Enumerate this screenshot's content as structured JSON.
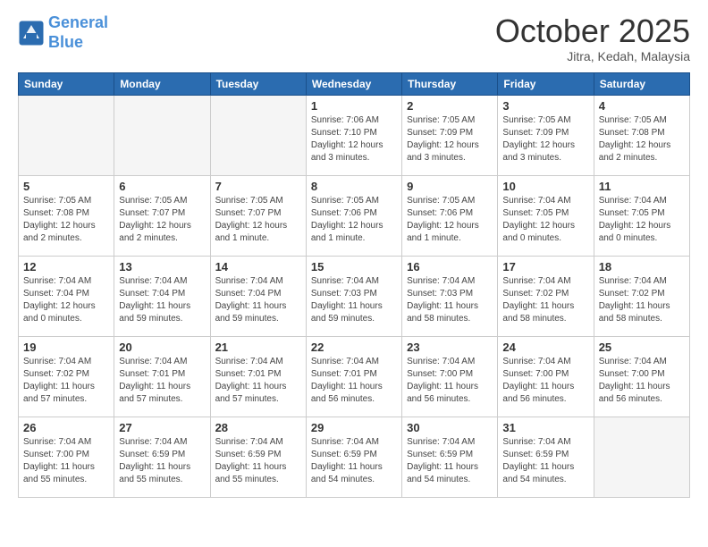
{
  "header": {
    "logo_line1": "General",
    "logo_line2": "Blue",
    "month": "October 2025",
    "location": "Jitra, Kedah, Malaysia"
  },
  "weekdays": [
    "Sunday",
    "Monday",
    "Tuesday",
    "Wednesday",
    "Thursday",
    "Friday",
    "Saturday"
  ],
  "weeks": [
    [
      {
        "day": "",
        "info": ""
      },
      {
        "day": "",
        "info": ""
      },
      {
        "day": "",
        "info": ""
      },
      {
        "day": "1",
        "info": "Sunrise: 7:06 AM\nSunset: 7:10 PM\nDaylight: 12 hours\nand 3 minutes."
      },
      {
        "day": "2",
        "info": "Sunrise: 7:05 AM\nSunset: 7:09 PM\nDaylight: 12 hours\nand 3 minutes."
      },
      {
        "day": "3",
        "info": "Sunrise: 7:05 AM\nSunset: 7:09 PM\nDaylight: 12 hours\nand 3 minutes."
      },
      {
        "day": "4",
        "info": "Sunrise: 7:05 AM\nSunset: 7:08 PM\nDaylight: 12 hours\nand 2 minutes."
      }
    ],
    [
      {
        "day": "5",
        "info": "Sunrise: 7:05 AM\nSunset: 7:08 PM\nDaylight: 12 hours\nand 2 minutes."
      },
      {
        "day": "6",
        "info": "Sunrise: 7:05 AM\nSunset: 7:07 PM\nDaylight: 12 hours\nand 2 minutes."
      },
      {
        "day": "7",
        "info": "Sunrise: 7:05 AM\nSunset: 7:07 PM\nDaylight: 12 hours\nand 1 minute."
      },
      {
        "day": "8",
        "info": "Sunrise: 7:05 AM\nSunset: 7:06 PM\nDaylight: 12 hours\nand 1 minute."
      },
      {
        "day": "9",
        "info": "Sunrise: 7:05 AM\nSunset: 7:06 PM\nDaylight: 12 hours\nand 1 minute."
      },
      {
        "day": "10",
        "info": "Sunrise: 7:04 AM\nSunset: 7:05 PM\nDaylight: 12 hours\nand 0 minutes."
      },
      {
        "day": "11",
        "info": "Sunrise: 7:04 AM\nSunset: 7:05 PM\nDaylight: 12 hours\nand 0 minutes."
      }
    ],
    [
      {
        "day": "12",
        "info": "Sunrise: 7:04 AM\nSunset: 7:04 PM\nDaylight: 12 hours\nand 0 minutes."
      },
      {
        "day": "13",
        "info": "Sunrise: 7:04 AM\nSunset: 7:04 PM\nDaylight: 11 hours\nand 59 minutes."
      },
      {
        "day": "14",
        "info": "Sunrise: 7:04 AM\nSunset: 7:04 PM\nDaylight: 11 hours\nand 59 minutes."
      },
      {
        "day": "15",
        "info": "Sunrise: 7:04 AM\nSunset: 7:03 PM\nDaylight: 11 hours\nand 59 minutes."
      },
      {
        "day": "16",
        "info": "Sunrise: 7:04 AM\nSunset: 7:03 PM\nDaylight: 11 hours\nand 58 minutes."
      },
      {
        "day": "17",
        "info": "Sunrise: 7:04 AM\nSunset: 7:02 PM\nDaylight: 11 hours\nand 58 minutes."
      },
      {
        "day": "18",
        "info": "Sunrise: 7:04 AM\nSunset: 7:02 PM\nDaylight: 11 hours\nand 58 minutes."
      }
    ],
    [
      {
        "day": "19",
        "info": "Sunrise: 7:04 AM\nSunset: 7:02 PM\nDaylight: 11 hours\nand 57 minutes."
      },
      {
        "day": "20",
        "info": "Sunrise: 7:04 AM\nSunset: 7:01 PM\nDaylight: 11 hours\nand 57 minutes."
      },
      {
        "day": "21",
        "info": "Sunrise: 7:04 AM\nSunset: 7:01 PM\nDaylight: 11 hours\nand 57 minutes."
      },
      {
        "day": "22",
        "info": "Sunrise: 7:04 AM\nSunset: 7:01 PM\nDaylight: 11 hours\nand 56 minutes."
      },
      {
        "day": "23",
        "info": "Sunrise: 7:04 AM\nSunset: 7:00 PM\nDaylight: 11 hours\nand 56 minutes."
      },
      {
        "day": "24",
        "info": "Sunrise: 7:04 AM\nSunset: 7:00 PM\nDaylight: 11 hours\nand 56 minutes."
      },
      {
        "day": "25",
        "info": "Sunrise: 7:04 AM\nSunset: 7:00 PM\nDaylight: 11 hours\nand 56 minutes."
      }
    ],
    [
      {
        "day": "26",
        "info": "Sunrise: 7:04 AM\nSunset: 7:00 PM\nDaylight: 11 hours\nand 55 minutes."
      },
      {
        "day": "27",
        "info": "Sunrise: 7:04 AM\nSunset: 6:59 PM\nDaylight: 11 hours\nand 55 minutes."
      },
      {
        "day": "28",
        "info": "Sunrise: 7:04 AM\nSunset: 6:59 PM\nDaylight: 11 hours\nand 55 minutes."
      },
      {
        "day": "29",
        "info": "Sunrise: 7:04 AM\nSunset: 6:59 PM\nDaylight: 11 hours\nand 54 minutes."
      },
      {
        "day": "30",
        "info": "Sunrise: 7:04 AM\nSunset: 6:59 PM\nDaylight: 11 hours\nand 54 minutes."
      },
      {
        "day": "31",
        "info": "Sunrise: 7:04 AM\nSunset: 6:59 PM\nDaylight: 11 hours\nand 54 minutes."
      },
      {
        "day": "",
        "info": ""
      }
    ]
  ]
}
